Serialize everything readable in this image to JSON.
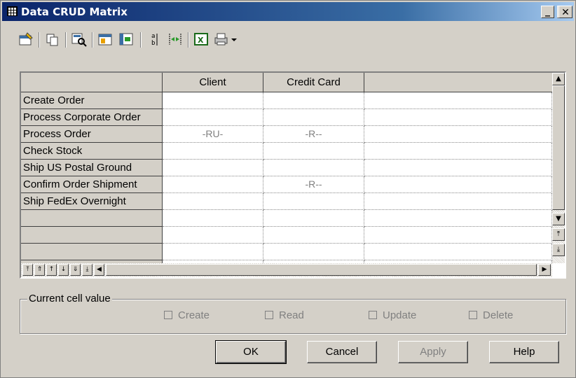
{
  "window": {
    "title": "Data CRUD Matrix"
  },
  "toolbar": {
    "icons": [
      "properties-icon",
      "copy-icon",
      "find-icon",
      "add-columns-icon",
      "add-rows-icon",
      "filter-icon",
      "adjust-columns-icon",
      "excel-export-icon",
      "print-icon"
    ]
  },
  "matrix": {
    "columns": [
      "Client",
      "Credit Card"
    ],
    "rows": [
      {
        "label": "Create Order",
        "cells": [
          "",
          ""
        ]
      },
      {
        "label": "Process Corporate Order",
        "cells": [
          "",
          ""
        ]
      },
      {
        "label": "Process Order",
        "cells": [
          "-RU-",
          "-R--"
        ]
      },
      {
        "label": "Check Stock",
        "cells": [
          "",
          ""
        ]
      },
      {
        "label": "Ship US Postal Ground",
        "cells": [
          "",
          ""
        ]
      },
      {
        "label": "Confirm Order Shipment",
        "cells": [
          "",
          "-R--"
        ]
      },
      {
        "label": "Ship FedEx Overnight",
        "cells": [
          "",
          ""
        ]
      },
      {
        "label": "",
        "cells": [
          "",
          ""
        ]
      },
      {
        "label": "",
        "cells": [
          "",
          ""
        ]
      },
      {
        "label": "",
        "cells": [
          "",
          ""
        ]
      },
      {
        "label": "",
        "cells": [
          "",
          ""
        ]
      }
    ]
  },
  "current_cell": {
    "group_label": "Current cell value",
    "options": [
      {
        "label": "Create",
        "checked": false
      },
      {
        "label": "Read",
        "checked": false
      },
      {
        "label": "Update",
        "checked": false
      },
      {
        "label": "Delete",
        "checked": false
      }
    ]
  },
  "buttons": {
    "ok": "OK",
    "cancel": "Cancel",
    "apply": "Apply",
    "help": "Help"
  },
  "colors": {
    "titlebar": "#0a246a",
    "face": "#d4d0c8",
    "cell_text": "#808080"
  }
}
